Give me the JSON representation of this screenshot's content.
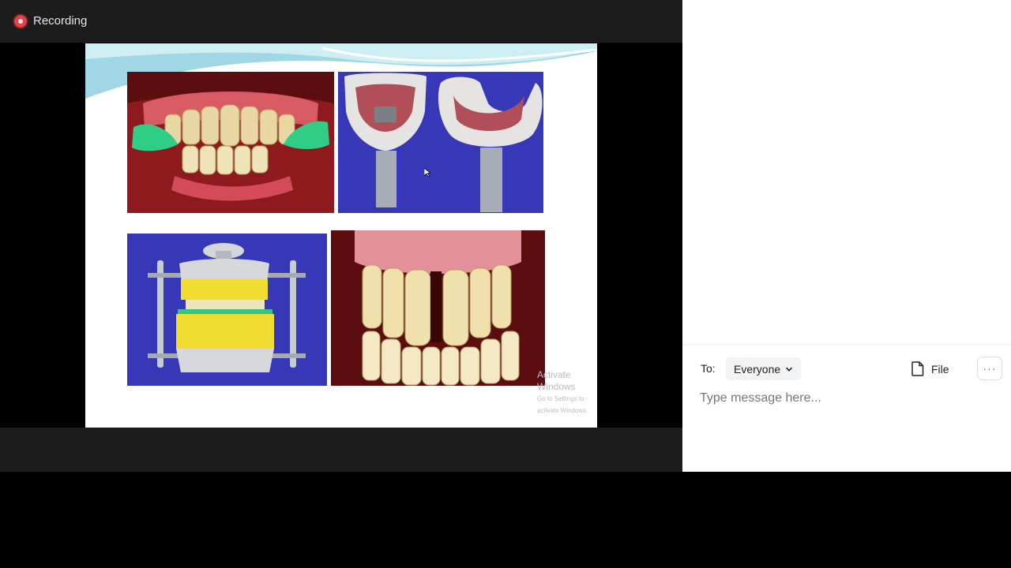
{
  "recording": {
    "label": "Recording"
  },
  "watermark": {
    "line1": "Activate Windows",
    "line2": "Go to Settings to activate Windows."
  },
  "chat": {
    "to_label": "To:",
    "recipient": "Everyone",
    "file_label": "File",
    "more_label": "···",
    "message_placeholder": "Type message here..."
  },
  "colors": {
    "recording_red": "#e0414a",
    "photo_blue": "#3b3db4",
    "slide_accent": "#8ed1de"
  },
  "icons": [
    "record-icon",
    "chevron-down-icon",
    "file-icon",
    "more-icon",
    "mouse-cursor-icon"
  ]
}
